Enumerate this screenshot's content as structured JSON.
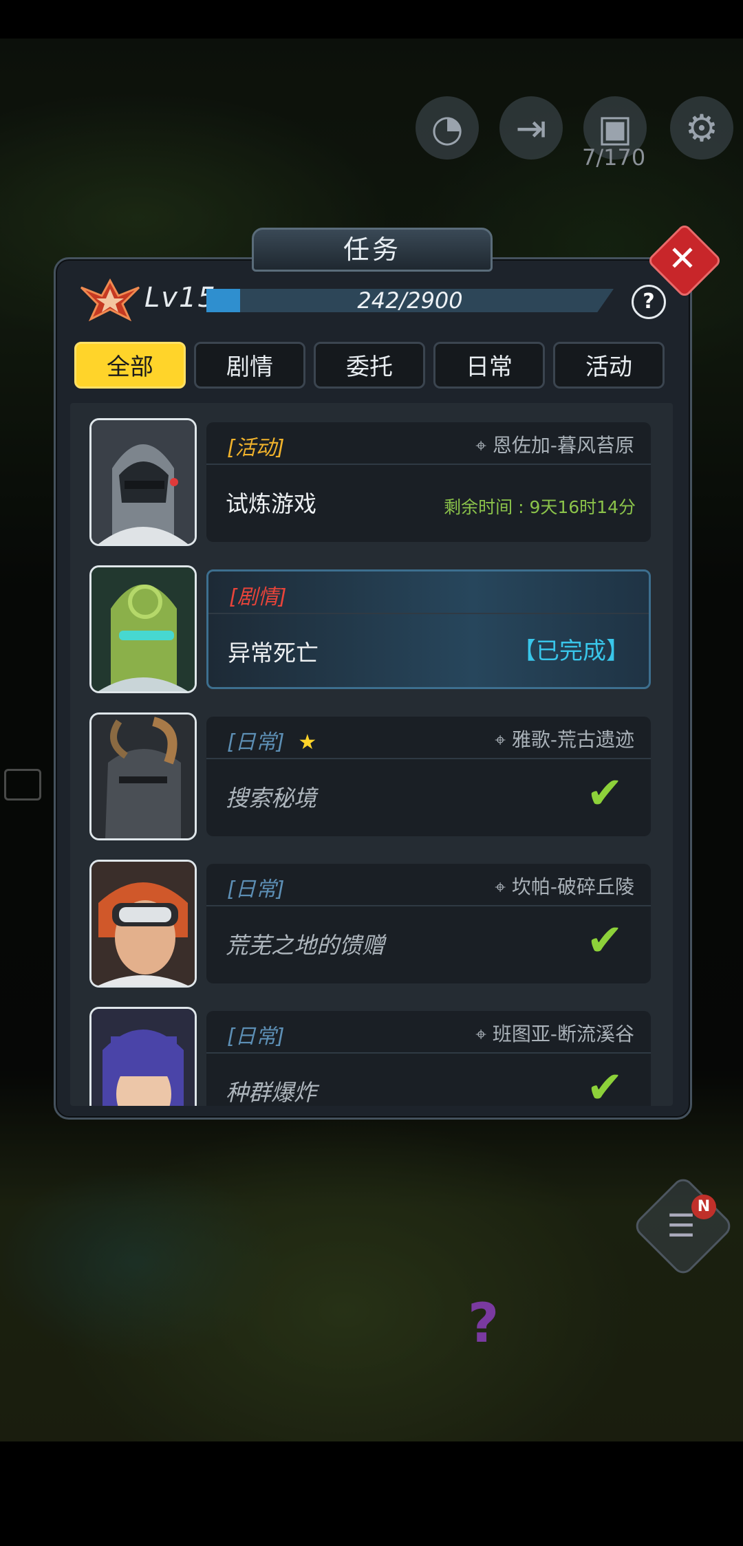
{
  "hud": {
    "storage_count": "7/170",
    "icons": [
      "radar-icon",
      "exit-icon",
      "backpack-icon",
      "gear-icon"
    ]
  },
  "quest_button": {
    "badge": "N"
  },
  "dialog": {
    "title": "任务",
    "level": "Lv15",
    "xp_text": "242/2900",
    "xp_fraction": 0.083,
    "help": "?",
    "close": "✕",
    "tabs": [
      "全部",
      "剧情",
      "委托",
      "日常",
      "活动"
    ],
    "active_tab": "全部"
  },
  "quests": [
    {
      "category": "[活动]",
      "category_color": "#f0b22c",
      "location": "恩佐加-暮风苔原",
      "name": "试炼游戏",
      "timer": "剩余时间 : 9天16时14分"
    },
    {
      "category": "[剧情]",
      "category_color": "#e8443a",
      "name": "异常死亡",
      "status": "【已完成】"
    },
    {
      "category": "[日常]",
      "category_color": "#5d8fb5",
      "location": "雅歌-荒古遗迹",
      "name": "搜索秘境",
      "starred": "★"
    },
    {
      "category": "[日常]",
      "category_color": "#5d8fb5",
      "location": "坎帕-破碎丘陵",
      "name": "荒芜之地的馈赠"
    },
    {
      "category": "[日常]",
      "category_color": "#5d8fb5",
      "location": "班图亚-断流溪谷",
      "name": "种群爆炸"
    }
  ]
}
